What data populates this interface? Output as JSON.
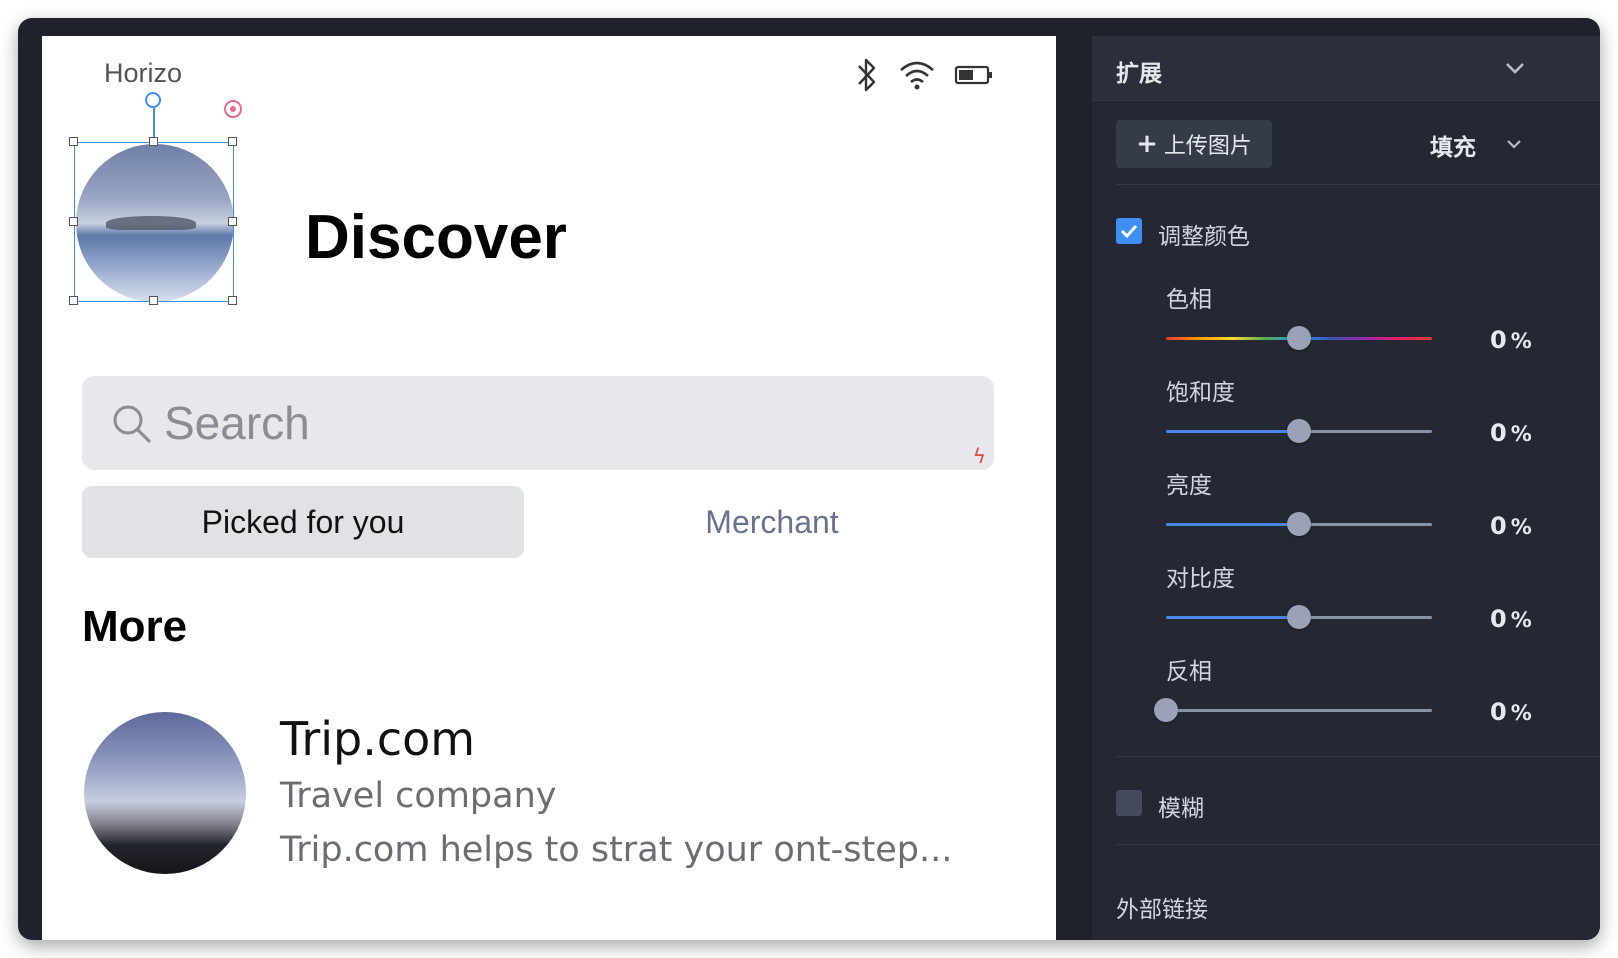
{
  "artboard": {
    "status_title": "Horizo",
    "discover_title": "Discover",
    "search": {
      "placeholder": "Search"
    },
    "segments": [
      {
        "label": "Picked for you",
        "selected": true
      },
      {
        "label": "Merchant",
        "selected": false
      }
    ],
    "section_title": "More",
    "list_item": {
      "name": "Trip.com",
      "type": "Travel company",
      "description": "Trip.com helps to strat your ont-step..."
    }
  },
  "panel": {
    "section_title": "扩展",
    "upload_label": "上传图片",
    "upload_plus": "+",
    "fill_mode": "填充",
    "adjust_color": {
      "label": "调整颜色",
      "checked": true
    },
    "sliders": [
      {
        "label": "色相",
        "value": "0",
        "unit": "%"
      },
      {
        "label": "饱和度",
        "value": "0",
        "unit": "%"
      },
      {
        "label": "亮度",
        "value": "0",
        "unit": "%"
      },
      {
        "label": "对比度",
        "value": "0",
        "unit": "%"
      },
      {
        "label": "反相",
        "value": "0",
        "unit": "%"
      }
    ],
    "blur": {
      "label": "模糊",
      "checked": false
    },
    "external_link": "外部链接"
  },
  "colors": {
    "panel_bg": "#252833",
    "accent_blue": "#3f8ef3",
    "selection_blue": "#3a8ff0"
  }
}
